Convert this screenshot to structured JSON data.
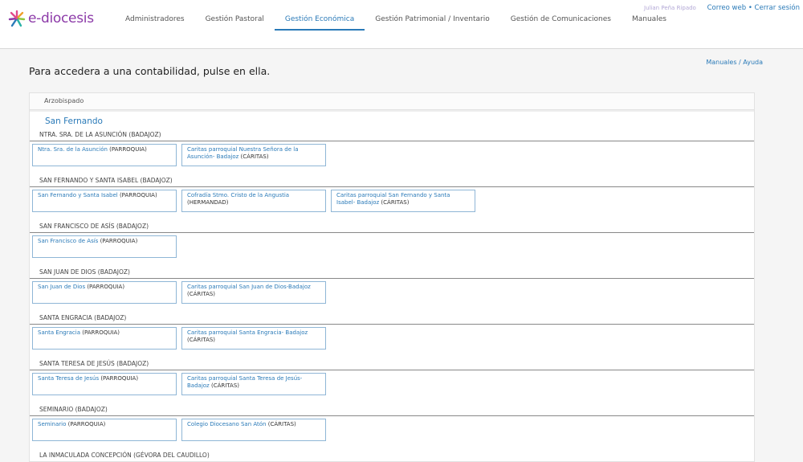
{
  "header": {
    "logo_text": "e-diocesis",
    "nav": [
      {
        "label": "Administradores",
        "active": false
      },
      {
        "label": "Gestión Pastoral",
        "active": false
      },
      {
        "label": "Gestión Económica",
        "active": true
      },
      {
        "label": "Gestión Patrimonial / Inventario",
        "active": false
      },
      {
        "label": "Gestión de Comunicaciones",
        "active": false
      },
      {
        "label": "Manuales",
        "active": false
      }
    ],
    "user_name": "Julian Peña Ripado",
    "links": {
      "mail": "Correo web",
      "separator": " • ",
      "logout": "Cerrar sesión"
    }
  },
  "main": {
    "title": "Para accedera a una contabilidad, pulse en ella.",
    "help": {
      "manuals": "Manuales",
      "separator": " / ",
      "help": "Ayuda"
    },
    "panel": {
      "header": "Arzobispado",
      "archpriesthood": "San Fernando",
      "sections": [
        {
          "title": "NTRA. SRA. DE LA ASUNCIÓN (BADAJOZ)",
          "entities": [
            {
              "name": "Ntra. Sra. de la Asunción",
              "type": "(PARROQUIA)"
            },
            {
              "name": "Caritas parroquial Nuestra Señora de la Asunción- Badajoz",
              "type": "(CÁRITAS)"
            }
          ]
        },
        {
          "title": "SAN FERNANDO Y SANTA ISABEL (BADAJOZ)",
          "entities": [
            {
              "name": "San Fernando y Santa Isabel",
              "type": "(PARROQUIA)"
            },
            {
              "name": "Cofradía Stmo. Cristo de la Angustia",
              "type": "(HERMANDAD)"
            },
            {
              "name": "Caritas parroquial San Fernando y Santa Isabel- Badajoz",
              "type": "(CÁRITAS)"
            }
          ]
        },
        {
          "title": "SAN FRANCISCO DE ASÍS (BADAJOZ)",
          "entities": [
            {
              "name": "San Francisco de Asís",
              "type": "(PARROQUIA)"
            }
          ]
        },
        {
          "title": "SAN JUAN DE DIOS (BADAJOZ)",
          "entities": [
            {
              "name": "San Juan de Dios",
              "type": "(PARROQUIA)"
            },
            {
              "name": "Caritas parroquial San Juan de Dios-Badajoz",
              "type": "(CÁRITAS)"
            }
          ]
        },
        {
          "title": "SANTA ENGRACIA (BADAJOZ)",
          "entities": [
            {
              "name": "Santa Engracia",
              "type": "(PARROQUIA)"
            },
            {
              "name": "Caritas parroquial Santa Engracia- Badajoz",
              "type": "(CÁRITAS)"
            }
          ]
        },
        {
          "title": "SANTA TERESA DE JESÚS (BADAJOZ)",
          "entities": [
            {
              "name": "Santa Teresa de Jesús",
              "type": "(PARROQUIA)"
            },
            {
              "name": "Caritas parroquial Santa Teresa de Jesús- Badajoz",
              "type": "(CÁRITAS)"
            }
          ]
        },
        {
          "title": "SEMINARIO (BADAJOZ)",
          "entities": [
            {
              "name": "Seminario",
              "type": "(PARROQUIA)"
            },
            {
              "name": "Colegio Diocesano San Atón",
              "type": "(CÁRITAS)"
            }
          ]
        },
        {
          "title": "LA INMACULADA CONCEPCIÓN (GÉVORA DEL CAUDILLO)",
          "entities": []
        }
      ]
    }
  },
  "colors": {
    "accent": "#2a7ab8",
    "logo": "#8c3aa8",
    "card_border": "#8fb6d6"
  }
}
